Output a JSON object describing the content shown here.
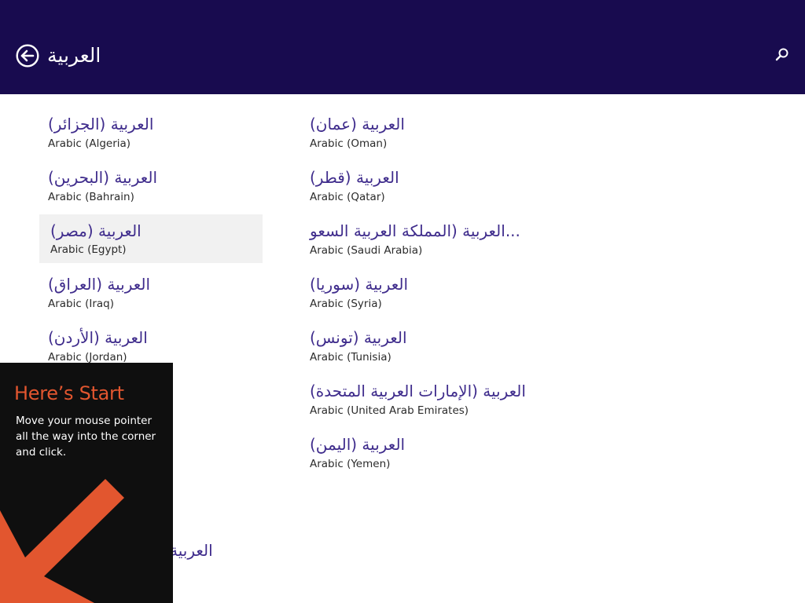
{
  "header": {
    "title": "العربية",
    "back_icon": "back-arrow-icon",
    "search_icon": "search-icon"
  },
  "languages": [
    {
      "native": "العربية (الجزائر)",
      "english": "Arabic (Algeria)"
    },
    {
      "native": "العربية (البحرين)",
      "english": "Arabic (Bahrain)"
    },
    {
      "native": "العربية (مصر)",
      "english": "Arabic (Egypt)",
      "selected": true
    },
    {
      "native": "العربية (العراق)",
      "english": "Arabic (Iraq)"
    },
    {
      "native": "العربية (الأردن)",
      "english": "Arabic (Jordan)"
    },
    {
      "native": "العربية (عمان)",
      "english": "Arabic (Oman)"
    },
    {
      "native": "العربية (قطر)",
      "english": "Arabic (Qatar)"
    },
    {
      "native": "العربية (المملكة العربية السعو...",
      "english": "Arabic (Saudi Arabia)"
    },
    {
      "native": "العربية (سوريا)",
      "english": "Arabic (Syria)"
    },
    {
      "native": "العربية (تونس)",
      "english": "Arabic (Tunisia)"
    },
    {
      "native": "العربية (الإمارات العربية المتحدة)",
      "english": "Arabic (United Arab Emirates)"
    },
    {
      "native": "العربية (اليمن)",
      "english": "Arabic (Yemen)"
    }
  ],
  "partial_item": "العربية",
  "start_tip": {
    "title": "Here’s Start",
    "text": "Move your mouse pointer all the way into the corner and click.",
    "arrow_icon": "arrow-down-left-icon",
    "accent_color": "#e2562f"
  },
  "colors": {
    "header_bg": "#180b4f",
    "item_native": "#3f2c8c",
    "selected_bg": "#f1f1f1"
  }
}
